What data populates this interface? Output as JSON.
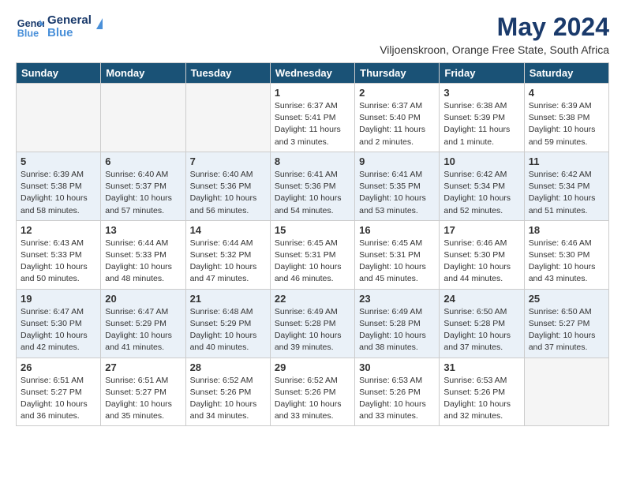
{
  "header": {
    "logo_general": "General",
    "logo_blue": "Blue",
    "month_title": "May 2024",
    "location": "Viljoenskroon, Orange Free State, South Africa"
  },
  "weekdays": [
    "Sunday",
    "Monday",
    "Tuesday",
    "Wednesday",
    "Thursday",
    "Friday",
    "Saturday"
  ],
  "weeks": [
    [
      {
        "day": "",
        "info": ""
      },
      {
        "day": "",
        "info": ""
      },
      {
        "day": "",
        "info": ""
      },
      {
        "day": "1",
        "info": "Sunrise: 6:37 AM\nSunset: 5:41 PM\nDaylight: 11 hours\nand 3 minutes."
      },
      {
        "day": "2",
        "info": "Sunrise: 6:37 AM\nSunset: 5:40 PM\nDaylight: 11 hours\nand 2 minutes."
      },
      {
        "day": "3",
        "info": "Sunrise: 6:38 AM\nSunset: 5:39 PM\nDaylight: 11 hours\nand 1 minute."
      },
      {
        "day": "4",
        "info": "Sunrise: 6:39 AM\nSunset: 5:38 PM\nDaylight: 10 hours\nand 59 minutes."
      }
    ],
    [
      {
        "day": "5",
        "info": "Sunrise: 6:39 AM\nSunset: 5:38 PM\nDaylight: 10 hours\nand 58 minutes."
      },
      {
        "day": "6",
        "info": "Sunrise: 6:40 AM\nSunset: 5:37 PM\nDaylight: 10 hours\nand 57 minutes."
      },
      {
        "day": "7",
        "info": "Sunrise: 6:40 AM\nSunset: 5:36 PM\nDaylight: 10 hours\nand 56 minutes."
      },
      {
        "day": "8",
        "info": "Sunrise: 6:41 AM\nSunset: 5:36 PM\nDaylight: 10 hours\nand 54 minutes."
      },
      {
        "day": "9",
        "info": "Sunrise: 6:41 AM\nSunset: 5:35 PM\nDaylight: 10 hours\nand 53 minutes."
      },
      {
        "day": "10",
        "info": "Sunrise: 6:42 AM\nSunset: 5:34 PM\nDaylight: 10 hours\nand 52 minutes."
      },
      {
        "day": "11",
        "info": "Sunrise: 6:42 AM\nSunset: 5:34 PM\nDaylight: 10 hours\nand 51 minutes."
      }
    ],
    [
      {
        "day": "12",
        "info": "Sunrise: 6:43 AM\nSunset: 5:33 PM\nDaylight: 10 hours\nand 50 minutes."
      },
      {
        "day": "13",
        "info": "Sunrise: 6:44 AM\nSunset: 5:33 PM\nDaylight: 10 hours\nand 48 minutes."
      },
      {
        "day": "14",
        "info": "Sunrise: 6:44 AM\nSunset: 5:32 PM\nDaylight: 10 hours\nand 47 minutes."
      },
      {
        "day": "15",
        "info": "Sunrise: 6:45 AM\nSunset: 5:31 PM\nDaylight: 10 hours\nand 46 minutes."
      },
      {
        "day": "16",
        "info": "Sunrise: 6:45 AM\nSunset: 5:31 PM\nDaylight: 10 hours\nand 45 minutes."
      },
      {
        "day": "17",
        "info": "Sunrise: 6:46 AM\nSunset: 5:30 PM\nDaylight: 10 hours\nand 44 minutes."
      },
      {
        "day": "18",
        "info": "Sunrise: 6:46 AM\nSunset: 5:30 PM\nDaylight: 10 hours\nand 43 minutes."
      }
    ],
    [
      {
        "day": "19",
        "info": "Sunrise: 6:47 AM\nSunset: 5:30 PM\nDaylight: 10 hours\nand 42 minutes."
      },
      {
        "day": "20",
        "info": "Sunrise: 6:47 AM\nSunset: 5:29 PM\nDaylight: 10 hours\nand 41 minutes."
      },
      {
        "day": "21",
        "info": "Sunrise: 6:48 AM\nSunset: 5:29 PM\nDaylight: 10 hours\nand 40 minutes."
      },
      {
        "day": "22",
        "info": "Sunrise: 6:49 AM\nSunset: 5:28 PM\nDaylight: 10 hours\nand 39 minutes."
      },
      {
        "day": "23",
        "info": "Sunrise: 6:49 AM\nSunset: 5:28 PM\nDaylight: 10 hours\nand 38 minutes."
      },
      {
        "day": "24",
        "info": "Sunrise: 6:50 AM\nSunset: 5:28 PM\nDaylight: 10 hours\nand 37 minutes."
      },
      {
        "day": "25",
        "info": "Sunrise: 6:50 AM\nSunset: 5:27 PM\nDaylight: 10 hours\nand 37 minutes."
      }
    ],
    [
      {
        "day": "26",
        "info": "Sunrise: 6:51 AM\nSunset: 5:27 PM\nDaylight: 10 hours\nand 36 minutes."
      },
      {
        "day": "27",
        "info": "Sunrise: 6:51 AM\nSunset: 5:27 PM\nDaylight: 10 hours\nand 35 minutes."
      },
      {
        "day": "28",
        "info": "Sunrise: 6:52 AM\nSunset: 5:26 PM\nDaylight: 10 hours\nand 34 minutes."
      },
      {
        "day": "29",
        "info": "Sunrise: 6:52 AM\nSunset: 5:26 PM\nDaylight: 10 hours\nand 33 minutes."
      },
      {
        "day": "30",
        "info": "Sunrise: 6:53 AM\nSunset: 5:26 PM\nDaylight: 10 hours\nand 33 minutes."
      },
      {
        "day": "31",
        "info": "Sunrise: 6:53 AM\nSunset: 5:26 PM\nDaylight: 10 hours\nand 32 minutes."
      },
      {
        "day": "",
        "info": ""
      }
    ]
  ]
}
